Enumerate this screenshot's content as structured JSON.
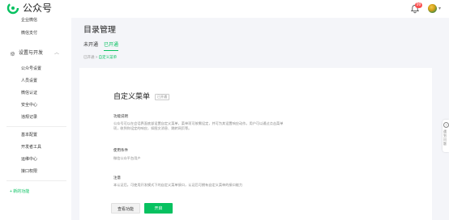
{
  "app": {
    "name": "公众号",
    "accent": "#07c160",
    "notification_count": "99"
  },
  "sidebar": {
    "top_items": [
      "企业微信",
      "微信支付"
    ],
    "group": {
      "label": "设置与开发",
      "icon": "gear-icon",
      "expanded": true
    },
    "group_items": [
      "公众号设置",
      "人员设置",
      "微信认证",
      "安全中心",
      "违规记录"
    ],
    "dev_items": [
      "基本配置",
      "开发者工具",
      "运维中心",
      "接口权限"
    ],
    "add_feature": "+ 新的功能"
  },
  "main": {
    "title": "目录管理",
    "tabs": [
      {
        "label": "未开通",
        "active": false
      },
      {
        "label": "已开通",
        "active": true
      }
    ],
    "breadcrumb": {
      "parent": "已开通",
      "sep": ">",
      "current": "自定义菜单"
    },
    "card": {
      "title": "自定义菜单",
      "tag": "已开通",
      "sections": [
        {
          "heading": "功能说明",
          "text": "公众号可以在会话界面底部设置自定义菜单，菜单项可按需设定，并可为其设置响应动作。用户可以通过点击菜单项，收到你设定的响应，如图文消息、跳转网页等。"
        },
        {
          "heading": "使用条件",
          "text": "微信公众平台用户"
        },
        {
          "heading": "注意",
          "text": "本认证后，可使用开发模式下的自定义菜单接口，认证后可拥有自定义菜单的接口能力"
        }
      ],
      "buttons": {
        "view": "查看功能",
        "enable": "开启"
      }
    }
  },
  "help": {
    "label": "遇到问题"
  }
}
